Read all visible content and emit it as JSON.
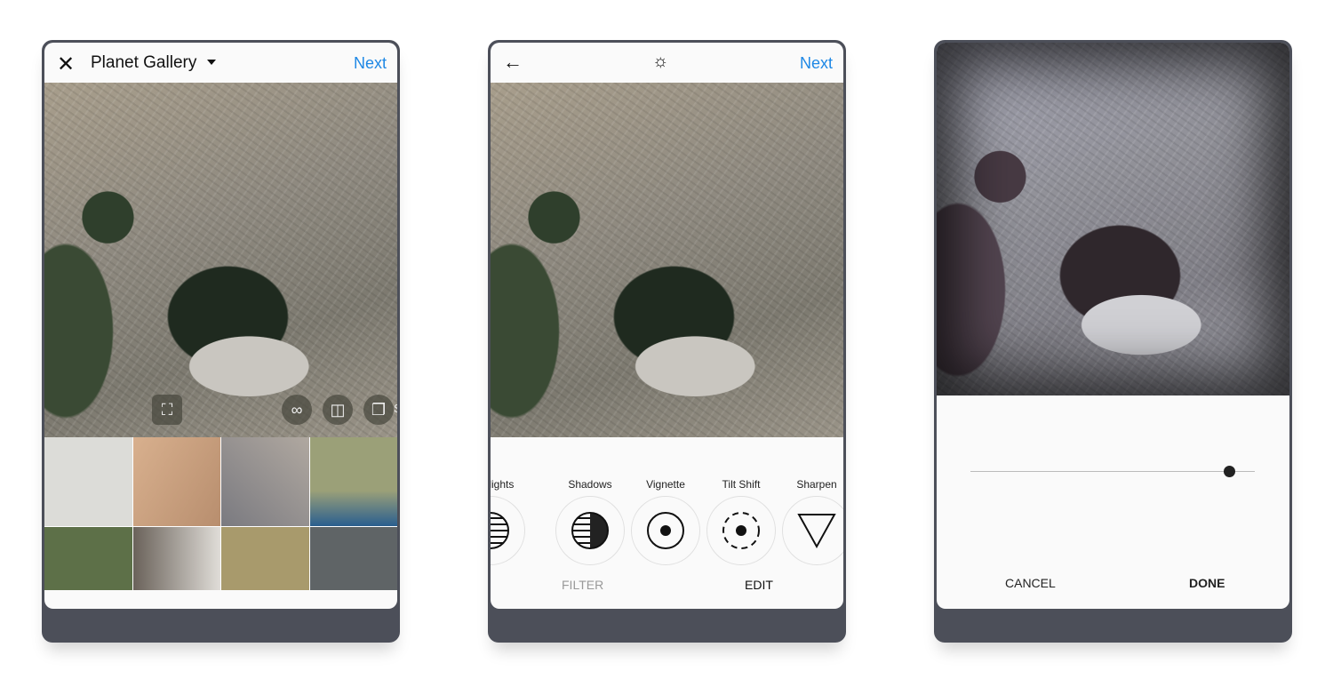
{
  "gallery": {
    "title": "Planet Gallery",
    "next_label": "Next",
    "overlay_partial_label": "S",
    "thumbnail_colors": [
      "#dcdcd8",
      "#c7a183",
      "#8e8a88",
      "#9ba078",
      "#5d7048",
      "#a39c94",
      "#a89a6c",
      "#5f6466"
    ],
    "blue_thumb_accent": "#2a5f8f"
  },
  "edit": {
    "next_label": "Next",
    "tools": [
      {
        "label": "Highlights",
        "icon": "highlights-icon"
      },
      {
        "label": "Shadows",
        "icon": "shadows-icon"
      },
      {
        "label": "Vignette",
        "icon": "vignette-icon"
      },
      {
        "label": "Tilt Shift",
        "icon": "tilt-shift-icon"
      },
      {
        "label": "Sharpen",
        "icon": "sharpen-icon"
      }
    ],
    "tabs": {
      "filter": "FILTER",
      "edit": "EDIT"
    }
  },
  "adjust": {
    "slider_value_fraction": 0.91,
    "cancel_label": "CANCEL",
    "done_label": "DONE"
  },
  "colors": {
    "accent": "#1e88e5",
    "frame": "#4c4f59"
  }
}
